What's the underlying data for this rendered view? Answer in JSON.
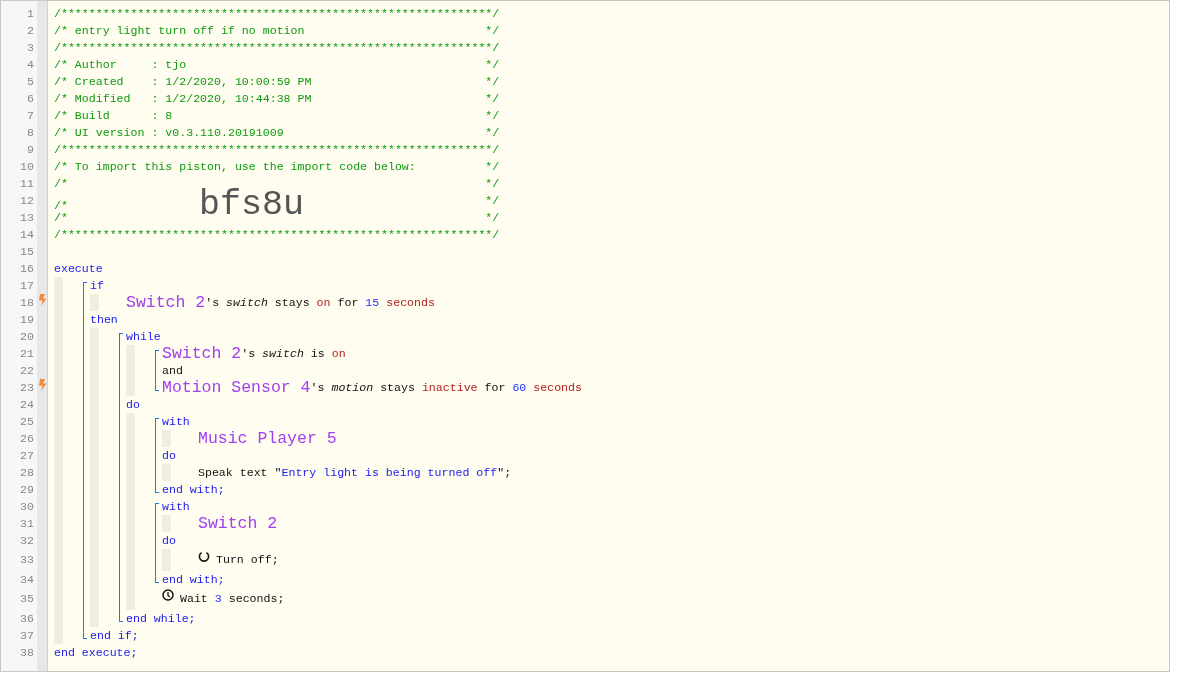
{
  "code": [
    {
      "kind": "line",
      "number": "1",
      "trigger": false,
      "tokens": [
        {
          "kind": "comment",
          "text": "/**************************************************************/"
        }
      ]
    },
    {
      "kind": "line",
      "number": "2",
      "trigger": false,
      "tokens": [
        {
          "kind": "comment",
          "text": "/* entry light turn off if no motion"
        },
        {
          "kind": "comment-end",
          "text": "*/"
        }
      ]
    },
    {
      "kind": "line",
      "number": "3",
      "trigger": false,
      "tokens": [
        {
          "kind": "comment",
          "text": "/**************************************************************/"
        }
      ]
    },
    {
      "kind": "line",
      "number": "4",
      "trigger": false,
      "tokens": [
        {
          "kind": "comment",
          "text": "/* Author     : tjo"
        },
        {
          "kind": "comment-end",
          "text": "*/"
        }
      ]
    },
    {
      "kind": "line",
      "number": "5",
      "trigger": false,
      "tokens": [
        {
          "kind": "comment",
          "text": "/* Created    : 1/2/2020, 10:00:59 PM"
        },
        {
          "kind": "comment-end",
          "text": "*/"
        }
      ]
    },
    {
      "kind": "line",
      "number": "6",
      "trigger": false,
      "tokens": [
        {
          "kind": "comment",
          "text": "/* Modified   : 1/2/2020, 10:44:38 PM"
        },
        {
          "kind": "comment-end",
          "text": "*/"
        }
      ]
    },
    {
      "kind": "line",
      "number": "7",
      "trigger": false,
      "tokens": [
        {
          "kind": "comment",
          "text": "/* Build      : 8"
        },
        {
          "kind": "comment-end",
          "text": "*/"
        }
      ]
    },
    {
      "kind": "line",
      "number": "8",
      "trigger": false,
      "tokens": [
        {
          "kind": "comment",
          "text": "/* UI version : v0.3.110.20191009"
        },
        {
          "kind": "comment-end",
          "text": "*/"
        }
      ]
    },
    {
      "kind": "line",
      "number": "9",
      "trigger": false,
      "tokens": [
        {
          "kind": "comment",
          "text": "/**************************************************************/"
        }
      ]
    },
    {
      "kind": "line",
      "number": "10",
      "trigger": false,
      "tokens": [
        {
          "kind": "comment",
          "text": "/* To import this piston, use the import code below:"
        },
        {
          "kind": "comment-end",
          "text": "*/"
        }
      ]
    },
    {
      "kind": "line",
      "number": "11",
      "trigger": false,
      "tokens": [
        {
          "kind": "comment",
          "text": "/*"
        },
        {
          "kind": "comment-end",
          "text": "*/"
        }
      ]
    },
    {
      "kind": "line",
      "number": "12",
      "trigger": false,
      "tokens": [
        {
          "kind": "comment",
          "text": "/*"
        },
        {
          "kind": "import-code",
          "text": "bfs8u"
        },
        {
          "kind": "comment-end",
          "text": "*/"
        }
      ]
    },
    {
      "kind": "line",
      "number": "13",
      "trigger": false,
      "tokens": [
        {
          "kind": "comment",
          "text": "/*"
        },
        {
          "kind": "comment-end",
          "text": "*/"
        }
      ]
    },
    {
      "kind": "line",
      "number": "14",
      "trigger": false,
      "tokens": [
        {
          "kind": "comment",
          "text": "/**************************************************************/"
        }
      ]
    },
    {
      "kind": "line",
      "number": "15",
      "trigger": false
    },
    {
      "kind": "line",
      "number": "16",
      "trigger": false,
      "tokens": [
        {
          "kind": "keyword",
          "text": "execute"
        }
      ]
    },
    {
      "kind": "indent",
      "children": [
        {
          "kind": "bracket",
          "children": [
            {
              "kind": "line",
              "number": "17",
              "trigger": false,
              "tokens": [
                {
                  "kind": "keyword",
                  "text": "if"
                }
              ]
            },
            {
              "kind": "indent",
              "children": [
                {
                  "kind": "line",
                  "number": "18",
                  "trigger": true,
                  "tokens": [
                    {
                      "kind": "device",
                      "text": "Switch 2"
                    },
                    {
                      "kind": "plain",
                      "text": "'s",
                      "attached": true
                    },
                    {
                      "kind": "attribute",
                      "text": "switch"
                    },
                    {
                      "kind": "plain",
                      "text": "stays"
                    },
                    {
                      "kind": "value",
                      "text": "on"
                    },
                    {
                      "kind": "plain",
                      "text": "for"
                    },
                    {
                      "kind": "number",
                      "text": "15"
                    },
                    {
                      "kind": "value",
                      "text": "seconds"
                    }
                  ]
                }
              ]
            },
            {
              "kind": "line",
              "number": "19",
              "trigger": false,
              "tokens": [
                {
                  "kind": "keyword",
                  "text": "then"
                }
              ]
            },
            {
              "kind": "indent",
              "children": [
                {
                  "kind": "bracket",
                  "children": [
                    {
                      "kind": "line",
                      "number": "20",
                      "trigger": false,
                      "tokens": [
                        {
                          "kind": "keyword",
                          "text": "while"
                        }
                      ]
                    },
                    {
                      "kind": "indent",
                      "children": [
                        {
                          "kind": "bracket",
                          "children": [
                            {
                              "kind": "line",
                              "number": "21",
                              "trigger": false,
                              "tokens": [
                                {
                                  "kind": "device",
                                  "text": "Switch 2"
                                },
                                {
                                  "kind": "plain",
                                  "text": "'s",
                                  "attached": true
                                },
                                {
                                  "kind": "attribute",
                                  "text": "switch"
                                },
                                {
                                  "kind": "plain",
                                  "text": "is"
                                },
                                {
                                  "kind": "value",
                                  "text": "on"
                                }
                              ]
                            },
                            {
                              "kind": "line",
                              "number": "22",
                              "trigger": false,
                              "tokens": [
                                {
                                  "kind": "plain",
                                  "text": "and"
                                }
                              ]
                            },
                            {
                              "kind": "line",
                              "number": "23",
                              "trigger": true,
                              "tokens": [
                                {
                                  "kind": "device",
                                  "text": "Motion Sensor 4"
                                },
                                {
                                  "kind": "plain",
                                  "text": "'s",
                                  "attached": true
                                },
                                {
                                  "kind": "attribute",
                                  "text": "motion"
                                },
                                {
                                  "kind": "plain",
                                  "text": "stays"
                                },
                                {
                                  "kind": "value",
                                  "text": "inactive"
                                },
                                {
                                  "kind": "plain",
                                  "text": "for"
                                },
                                {
                                  "kind": "number",
                                  "text": "60"
                                },
                                {
                                  "kind": "value",
                                  "text": "seconds"
                                }
                              ]
                            }
                          ]
                        }
                      ]
                    },
                    {
                      "kind": "line",
                      "number": "24",
                      "trigger": false,
                      "tokens": [
                        {
                          "kind": "keyword",
                          "text": "do"
                        }
                      ]
                    },
                    {
                      "kind": "indent",
                      "children": [
                        {
                          "kind": "bracket",
                          "children": [
                            {
                              "kind": "line",
                              "number": "25",
                              "trigger": false,
                              "tokens": [
                                {
                                  "kind": "keyword",
                                  "text": "with"
                                }
                              ]
                            },
                            {
                              "kind": "indent",
                              "children": [
                                {
                                  "kind": "line",
                                  "number": "26",
                                  "trigger": false,
                                  "tokens": [
                                    {
                                      "kind": "device",
                                      "text": "Music Player 5"
                                    }
                                  ]
                                }
                              ]
                            },
                            {
                              "kind": "line",
                              "number": "27",
                              "trigger": false,
                              "tokens": [
                                {
                                  "kind": "keyword",
                                  "text": "do"
                                }
                              ]
                            },
                            {
                              "kind": "indent",
                              "children": [
                                {
                                  "kind": "line",
                                  "number": "28",
                                  "trigger": false,
                                  "tokens": [
                                    {
                                      "kind": "plain",
                                      "text": "Speak text \""
                                    },
                                    {
                                      "kind": "string",
                                      "text": "Entry light is being turned off",
                                      "attached": true
                                    },
                                    {
                                      "kind": "plain",
                                      "text": "\";",
                                      "attached": true
                                    }
                                  ]
                                }
                              ]
                            },
                            {
                              "kind": "line",
                              "number": "29",
                              "trigger": false,
                              "tokens": [
                                {
                                  "kind": "keyword",
                                  "text": "end with;"
                                }
                              ]
                            }
                          ]
                        },
                        {
                          "kind": "bracket",
                          "children": [
                            {
                              "kind": "line",
                              "number": "30",
                              "trigger": false,
                              "tokens": [
                                {
                                  "kind": "keyword",
                                  "text": "with"
                                }
                              ]
                            },
                            {
                              "kind": "indent",
                              "children": [
                                {
                                  "kind": "line",
                                  "number": "31",
                                  "trigger": false,
                                  "tokens": [
                                    {
                                      "kind": "device",
                                      "text": "Switch 2"
                                    }
                                  ]
                                }
                              ]
                            },
                            {
                              "kind": "line",
                              "number": "32",
                              "trigger": false,
                              "tokens": [
                                {
                                  "kind": "keyword",
                                  "text": "do"
                                }
                              ]
                            },
                            {
                              "kind": "indent",
                              "children": [
                                {
                                  "kind": "action",
                                  "number": "33",
                                  "trigger": false,
                                  "tokens": [
                                    {
                                      "kind": "plain",
                                      "text": "Turn off;"
                                    }
                                  ]
                                }
                              ]
                            },
                            {
                              "kind": "line",
                              "number": "34",
                              "trigger": false,
                              "tokens": [
                                {
                                  "kind": "keyword",
                                  "text": "end with;"
                                }
                              ]
                            }
                          ]
                        },
                        {
                          "kind": "wait",
                          "number": "35",
                          "trigger": false,
                          "tokens": [
                            {
                              "kind": "plain",
                              "text": "Wait"
                            },
                            {
                              "kind": "number",
                              "text": "3"
                            },
                            {
                              "kind": "plain",
                              "text": "seconds;"
                            }
                          ]
                        }
                      ]
                    },
                    {
                      "kind": "line",
                      "number": "36",
                      "trigger": false,
                      "tokens": [
                        {
                          "kind": "keyword",
                          "text": "end while;"
                        }
                      ]
                    }
                  ]
                }
              ]
            },
            {
              "kind": "line",
              "number": "37",
              "trigger": false,
              "tokens": [
                {
                  "kind": "keyword",
                  "text": "end if;"
                }
              ]
            }
          ]
        }
      ]
    },
    {
      "kind": "line",
      "number": "38",
      "trigger": false,
      "tokens": [
        {
          "kind": "keyword",
          "text": "end execute;"
        }
      ]
    }
  ]
}
